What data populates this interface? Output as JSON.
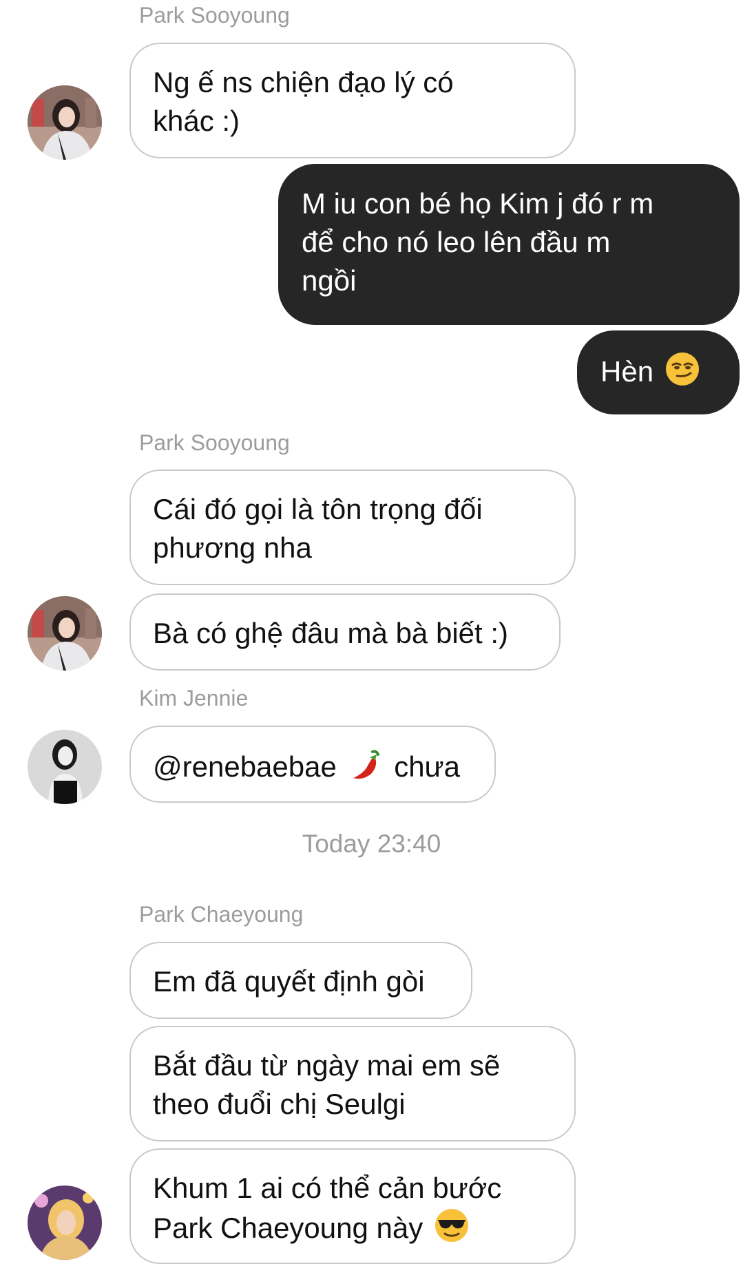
{
  "conversation": {
    "timestamp": "Today 23:40",
    "groups": [
      {
        "sender": "Park Sooyoung",
        "messages": [
          {
            "lines": [
              "Ng ế ns chiện đạo lý có",
              "khác :)"
            ]
          }
        ]
      },
      {
        "sender": "",
        "outgoing": true,
        "messages": [
          {
            "lines": [
              "M iu con bé họ Kim j đó r m",
              "để cho nó leo lên đầu m",
              "ngồi"
            ]
          },
          {
            "text": "Hèn",
            "emoji": "smirking-face-emoji"
          }
        ]
      },
      {
        "sender": "Park Sooyoung",
        "messages": [
          {
            "lines": [
              "Cái đó gọi là tôn trọng đối",
              "phương nha"
            ]
          },
          {
            "text": "Bà có ghệ đâu mà bà biết :)"
          }
        ]
      },
      {
        "sender": "Kim Jennie",
        "messages": [
          {
            "mention": "@renebaebae",
            "emoji": "hot-pepper-emoji",
            "text_after": "chưa"
          }
        ]
      },
      {
        "sender": "Park Chaeyoung",
        "messages": [
          {
            "text": "Em đã quyết định gòi"
          },
          {
            "lines": [
              "Bắt đầu từ ngày mai em sẽ",
              "theo đuổi chị Seulgi"
            ]
          },
          {
            "lines": [
              "Khum 1 ai có thể cản bước",
              "Park Chaeyoung này"
            ],
            "emoji": "sunglasses-face-emoji"
          }
        ]
      }
    ]
  },
  "colors": {
    "incoming_bubble_bg": "#ffffff",
    "incoming_bubble_border": "#c9c9c9",
    "outgoing_bubble_bg": "#262626",
    "outgoing_text": "#ffffff",
    "meta_text": "#9c9c9c"
  }
}
